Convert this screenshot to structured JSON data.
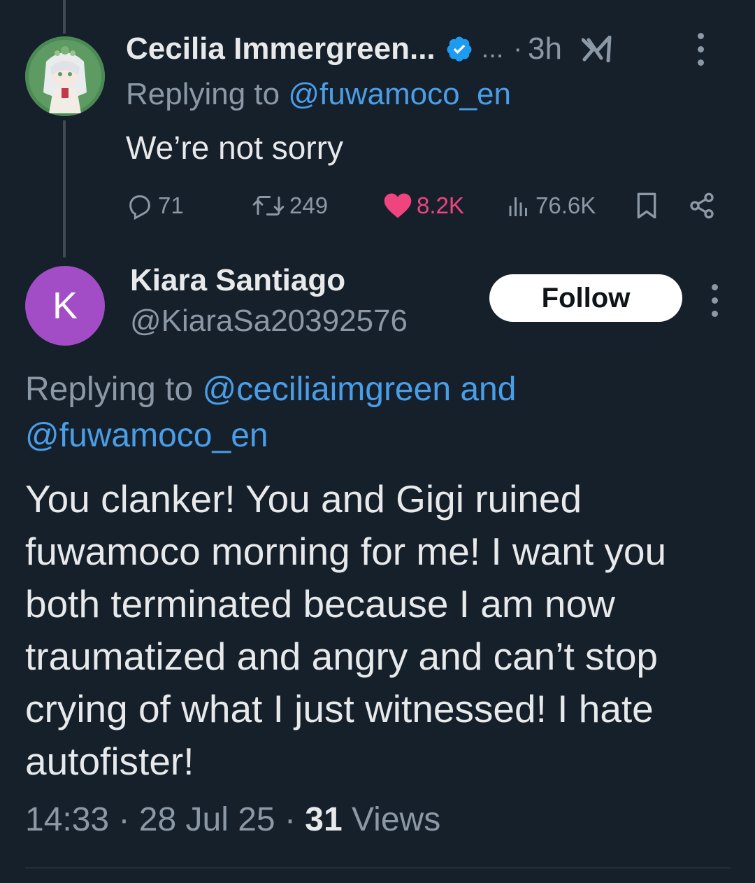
{
  "parent_tweet": {
    "display_name": "Cecilia Immergreen...",
    "overflow_dots": "...",
    "separator": "·",
    "time": "3h",
    "replying_to_prefix": "Replying to",
    "replying_to_handle": "@fuwamoco_en",
    "text": "We’re not sorry",
    "stats": {
      "replies": "71",
      "reposts": "249",
      "likes": "8.2K",
      "views": "76.6K"
    }
  },
  "reply_tweet": {
    "avatar_letter": "K",
    "display_name": "Kiara Santiago",
    "handle": "@KiaraSa20392576",
    "follow_label": "Follow",
    "replying_to_prefix": "Replying to",
    "replying_to_handle_1": "@ceciliaimgreen",
    "replying_to_joiner": "and",
    "replying_to_handle_2": "@fuwamoco_en",
    "text_lines": [
      "You clanker! You and Gigi ruined",
      "fuwamoco morning for me! I want you",
      "both terminated because I am now",
      "traumatized and angry and can’t stop",
      "crying of what I just witnessed! I hate",
      "autofister!"
    ],
    "time": "14:33",
    "date": "28 Jul 25",
    "separator": "·",
    "views_count": "31",
    "views_label": "Views"
  },
  "colors": {
    "background": "#16202b",
    "link": "#4a9ee8",
    "like": "#f0447f",
    "muted": "#8b98a5",
    "avatar_k": "#a24cc6"
  }
}
